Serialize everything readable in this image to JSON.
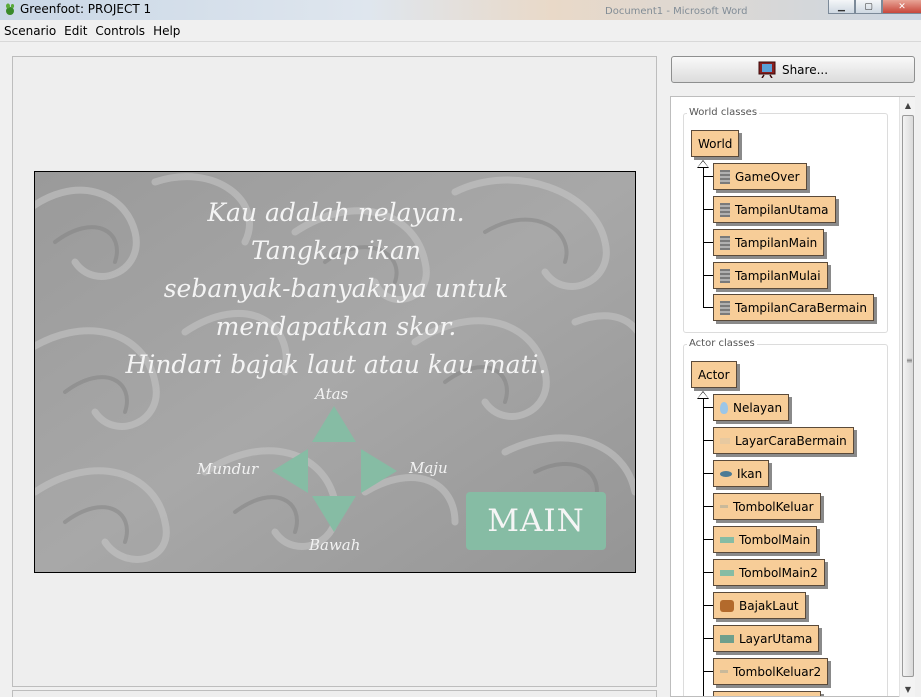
{
  "window": {
    "title": "Greenfoot: PROJECT 1",
    "background_text": "Document1 - Microsoft Word"
  },
  "menu": [
    "Scenario",
    "Edit",
    "Controls",
    "Help"
  ],
  "world": {
    "message_lines": [
      "Kau adalah nelayan.",
      "Tangkap ikan",
      "sebanyak-banyaknya untuk",
      "mendapatkan skor.",
      "Hindari bajak laut atau kau mati."
    ],
    "labels": {
      "up": "Atas",
      "left": "Mundur",
      "right": "Maju",
      "down": "Bawah"
    },
    "main_button": "MAIN",
    "colors": {
      "arrow": "#86bca4",
      "button": "#86bca4"
    }
  },
  "share_button": "Share...",
  "world_classes": {
    "title": "World classes",
    "root": "World",
    "children": [
      "GameOver",
      "TampilanUtama",
      "TampilanMain",
      "TampilanMulai",
      "TampilanCaraBermain"
    ]
  },
  "actor_classes": {
    "title": "Actor classes",
    "root": "Actor",
    "children": [
      {
        "name": "Nelayan",
        "icon": "fisherman-icon"
      },
      {
        "name": "LayarCaraBermain",
        "icon": "screen-icon"
      },
      {
        "name": "Ikan",
        "icon": "fish-icon"
      },
      {
        "name": "TombolKeluar",
        "icon": "button-icon"
      },
      {
        "name": "TombolMain",
        "icon": "button-icon"
      },
      {
        "name": "TombolMain2",
        "icon": "button-icon"
      },
      {
        "name": "BajakLaut",
        "icon": "pirate-icon"
      },
      {
        "name": "LayarUtama",
        "icon": "screen-icon"
      },
      {
        "name": "TombolKeluar2",
        "icon": "button-icon"
      }
    ]
  }
}
